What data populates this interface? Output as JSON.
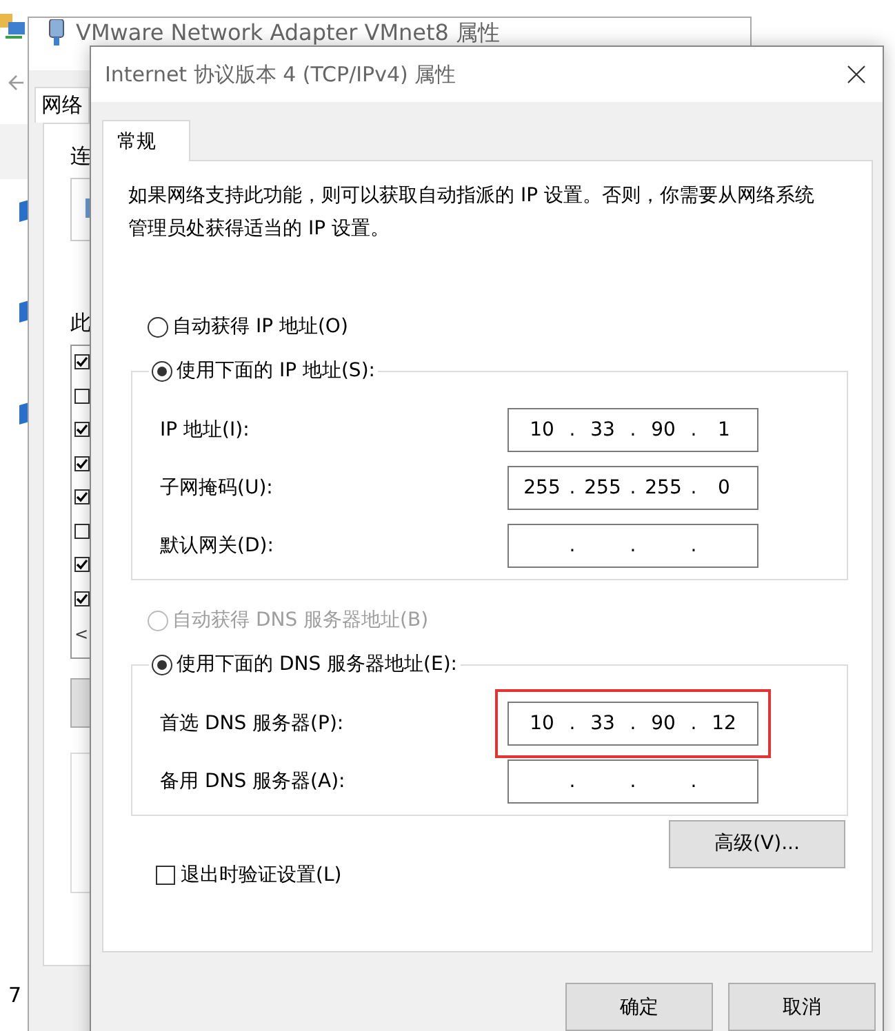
{
  "far_window": {
    "footer_text": "7"
  },
  "back_window": {
    "title": "VMware Network Adapter VMnet8 属性",
    "tab": "网络",
    "connect_label": "连",
    "items_label": "此",
    "items": [
      {
        "checked": true
      },
      {
        "checked": false
      },
      {
        "checked": true
      },
      {
        "checked": true
      },
      {
        "checked": true
      },
      {
        "checked": false
      },
      {
        "checked": true
      },
      {
        "checked": true
      }
    ],
    "scroll_arrow": "<"
  },
  "dialog": {
    "title": "Internet 协议版本 4 (TCP/IPv4) 属性",
    "tabs": [
      {
        "label": "常规",
        "selected": true
      }
    ],
    "description": "如果网络支持此功能，则可以获取自动指派的 IP 设置。否则，你需要从网络系统管理员处获得适当的 IP 设置。",
    "ip_radios": [
      {
        "label": "自动获得 IP 地址(O)",
        "selected": false,
        "disabled": false
      },
      {
        "label": "使用下面的 IP 地址(S):",
        "selected": true,
        "disabled": false
      }
    ],
    "ip_fields": [
      {
        "label": "IP 地址(I):",
        "octets": [
          "10",
          "33",
          "90",
          "1"
        ],
        "separator": ".",
        "highlighted": false
      },
      {
        "label": "子网掩码(U):",
        "octets": [
          "255",
          "255",
          "255",
          "0"
        ],
        "separator": ".",
        "highlighted": false
      },
      {
        "label": "默认网关(D):",
        "separator": ".",
        "highlighted": false
      }
    ],
    "dns_radios": [
      {
        "label": "自动获得 DNS 服务器地址(B)",
        "selected": false,
        "disabled": true
      },
      {
        "label": "使用下面的 DNS 服务器地址(E):",
        "selected": true,
        "disabled": false
      }
    ],
    "dns_fields": [
      {
        "label": "首选 DNS 服务器(P):",
        "octets": [
          "10",
          "33",
          "90",
          "12"
        ],
        "separator": ".",
        "highlighted": true
      },
      {
        "label": "备用 DNS 服务器(A):",
        "separator": ".",
        "highlighted": false
      }
    ],
    "validate_checkbox": {
      "label": "退出时验证设置(L)",
      "checked": false
    },
    "advanced_button": "高级(V)...",
    "buttons": [
      "确定",
      "取消"
    ]
  }
}
